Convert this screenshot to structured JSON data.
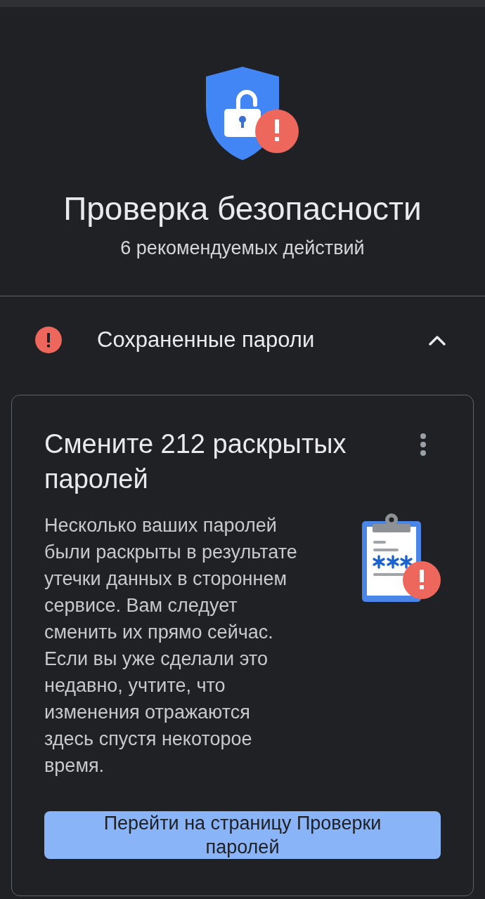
{
  "header": {
    "title": "Проверка безопасности",
    "subtitle": "6 рекомендуемых действий"
  },
  "section": {
    "title": "Сохраненные пароли",
    "expanded": true
  },
  "card": {
    "title": "Смените 212 раскрытых паролей",
    "body": "Несколько ваших паролей были раскрыты в результате утечки данных в стороннем сервисе. Вам следует сменить их прямо сейчас. Если вы уже сделали это недавно, учтите, что изменения отражаются здесь спустя некоторое время.",
    "button": "Перейти на страницу Проверки паролей"
  }
}
